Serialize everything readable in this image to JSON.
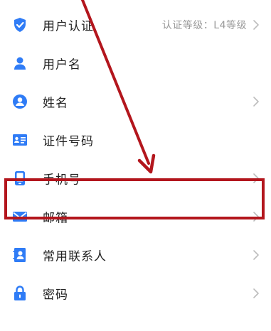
{
  "menu": {
    "items": [
      {
        "label": "用户认证",
        "value": "认证等级：L4等级",
        "icon": "shield-check-icon",
        "has_chevron": true
      },
      {
        "label": "用户名",
        "value": "",
        "icon": "person-icon",
        "has_chevron": false
      },
      {
        "label": "姓名",
        "value": "",
        "icon": "user-circle-icon",
        "has_chevron": true
      },
      {
        "label": "证件号码",
        "value": "",
        "icon": "id-card-icon",
        "has_chevron": false
      },
      {
        "label": "手机号",
        "value": "",
        "icon": "mobile-phone-icon",
        "has_chevron": true
      },
      {
        "label": "邮箱",
        "value": "",
        "icon": "mail-icon",
        "has_chevron": true
      },
      {
        "label": "常用联系人",
        "value": "",
        "icon": "contacts-icon",
        "has_chevron": true
      },
      {
        "label": "密码",
        "value": "",
        "icon": "lock-icon",
        "has_chevron": true
      }
    ]
  },
  "colors": {
    "icon_blue": "#2f7cf6",
    "annotation_red": "#b3161d",
    "label_text": "#222222",
    "value_text": "#9a9a9a",
    "chevron": "#bdbdbd"
  }
}
